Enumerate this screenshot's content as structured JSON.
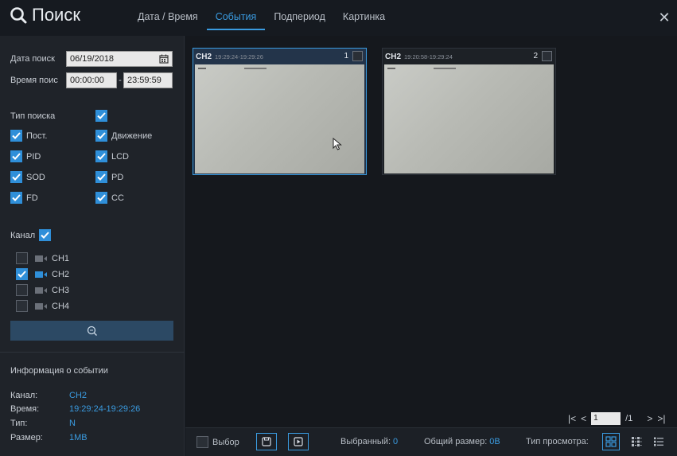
{
  "header": {
    "title": "Поиск",
    "tabs": [
      {
        "label": "Дата / Время",
        "active": false
      },
      {
        "label": "События",
        "active": true
      },
      {
        "label": "Подпериод",
        "active": false
      },
      {
        "label": "Картинка",
        "active": false
      }
    ],
    "close_label": "✕"
  },
  "sidebar": {
    "date_label": "Дата поиск",
    "date_value": "06/19/2018",
    "time_label": "Время поис",
    "time_start": "00:00:00",
    "time_sep": "-",
    "time_end": "23:59:59",
    "search_type_label": "Тип поиска",
    "event_types": [
      {
        "label": "Пост.",
        "checked": true
      },
      {
        "label": "Движение",
        "checked": true
      },
      {
        "label": "PID",
        "checked": true
      },
      {
        "label": "LCD",
        "checked": true
      },
      {
        "label": "SOD",
        "checked": true
      },
      {
        "label": "PD",
        "checked": true
      },
      {
        "label": "FD",
        "checked": true
      },
      {
        "label": "CC",
        "checked": true
      }
    ],
    "channel_label": "Канал",
    "channels": [
      {
        "label": "CH1",
        "checked": false
      },
      {
        "label": "CH2",
        "checked": true
      },
      {
        "label": "CH3",
        "checked": false
      },
      {
        "label": "CH4",
        "checked": false
      }
    ],
    "event_info": {
      "title": "Информация о событии",
      "rows": [
        {
          "key": "Канал:",
          "value": "CH2"
        },
        {
          "key": "Время:",
          "value": "19:29:24-19:29:26"
        },
        {
          "key": "Тип:",
          "value": "N"
        },
        {
          "key": "Размер:",
          "value": "1MB"
        }
      ]
    }
  },
  "results": [
    {
      "channel": "CH2",
      "time": "19:29:24-19:29:26",
      "index": "1",
      "selected": true
    },
    {
      "channel": "CH2",
      "time": "19:20:58-19:29:24",
      "index": "2",
      "selected": false
    }
  ],
  "pager": {
    "page": "1",
    "total": "/1"
  },
  "footer": {
    "select_label": "Выбор",
    "selected_label": "Выбранный:",
    "selected_value": "0",
    "total_size_label": "Общий размер:",
    "total_size_value": "0B",
    "view_type_label": "Тип просмотра:"
  },
  "colors": {
    "accent": "#3a9be0",
    "panel": "#1f2329",
    "background": "#161a20"
  }
}
